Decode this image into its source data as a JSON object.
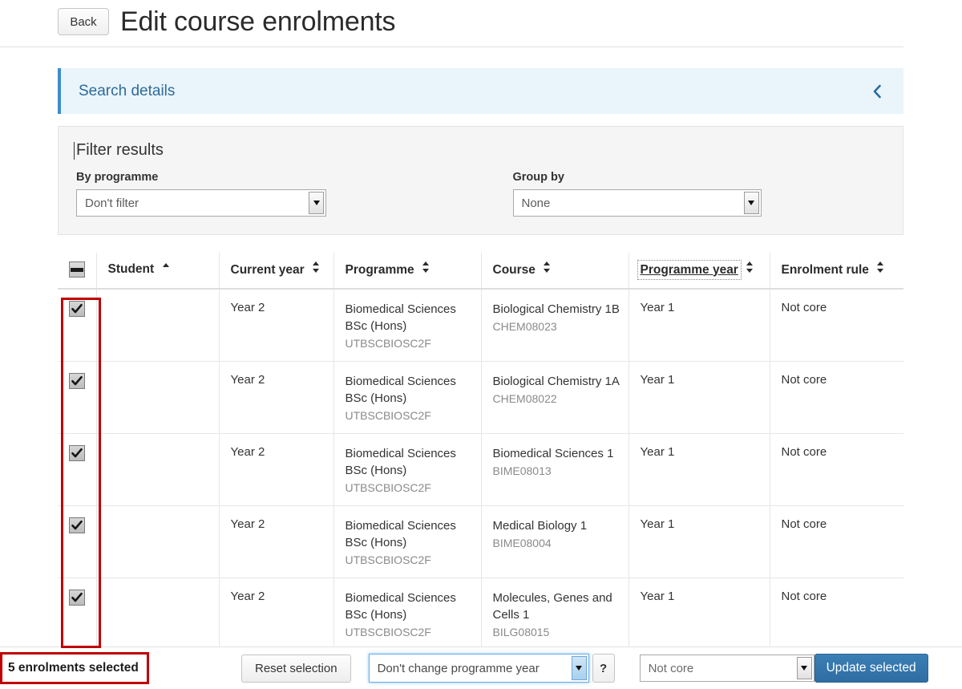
{
  "header": {
    "back_label": "Back",
    "title": "Edit course enrolments"
  },
  "search_panel": {
    "title": "Search details",
    "collapse_icon": "chevron-left-icon"
  },
  "filter_card": {
    "heading": "Filter results",
    "by_programme_label": "By programme",
    "by_programme_value": "Don't filter",
    "group_by_label": "Group by",
    "group_by_value": "None"
  },
  "table": {
    "columns": [
      {
        "key": "select",
        "label": "",
        "sortable": false
      },
      {
        "key": "student",
        "label": "Student",
        "sort": "asc"
      },
      {
        "key": "current_year",
        "label": "Current year",
        "sort": "none"
      },
      {
        "key": "programme",
        "label": "Programme",
        "sort": "none"
      },
      {
        "key": "course",
        "label": "Course",
        "sort": "none"
      },
      {
        "key": "programme_year",
        "label": "Programme year",
        "sort": "none",
        "hovered": true
      },
      {
        "key": "enrolment_rule",
        "label": "Enrolment rule",
        "sort": "none"
      }
    ],
    "header_checkbox_state": "indeterminate",
    "rows": [
      {
        "checked": true,
        "student": "",
        "current_year": "Year 2",
        "programme": "Biomedical Sciences BSc (Hons)",
        "programme_code": "UTBSCBIOSC2F",
        "course": "Biological Chemistry 1B",
        "course_code": "CHEM08023",
        "programme_year": "Year 1",
        "enrolment_rule": "Not core"
      },
      {
        "checked": true,
        "student": "",
        "current_year": "Year 2",
        "programme": "Biomedical Sciences BSc (Hons)",
        "programme_code": "UTBSCBIOSC2F",
        "course": "Biological Chemistry 1A",
        "course_code": "CHEM08022",
        "programme_year": "Year 1",
        "enrolment_rule": "Not core"
      },
      {
        "checked": true,
        "student": "",
        "current_year": "Year 2",
        "programme": "Biomedical Sciences BSc (Hons)",
        "programme_code": "UTBSCBIOSC2F",
        "course": "Biomedical Sciences 1",
        "course_code": "BIME08013",
        "programme_year": "Year 1",
        "enrolment_rule": "Not core"
      },
      {
        "checked": true,
        "student": "",
        "current_year": "Year 2",
        "programme": "Biomedical Sciences BSc (Hons)",
        "programme_code": "UTBSCBIOSC2F",
        "course": "Medical Biology 1",
        "course_code": "BIME08004",
        "programme_year": "Year 1",
        "enrolment_rule": "Not core"
      },
      {
        "checked": true,
        "student": "",
        "current_year": "Year 2",
        "programme": "Biomedical Sciences BSc (Hons)",
        "programme_code": "UTBSCBIOSC2F",
        "course": "Molecules, Genes and Cells 1",
        "course_code": "BILG08015",
        "programme_year": "Year 1",
        "enrolment_rule": "Not core"
      }
    ]
  },
  "bottom_bar": {
    "selection_count": "5 enrolments selected",
    "reset_label": "Reset selection",
    "programme_year_value": "Don't change programme year",
    "help_label": "?",
    "enrolment_rule_value": "Not core",
    "update_label": "Update selected"
  },
  "colors": {
    "accent_blue": "#2f6da3",
    "panel_blue": "#eaf4fb",
    "panel_border_blue": "#3f8ccb",
    "annotation_red": "#c00000",
    "link_blue": "#2c6c99"
  }
}
